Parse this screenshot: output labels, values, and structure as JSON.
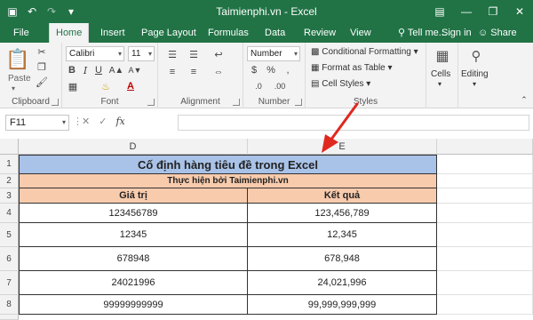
{
  "window": {
    "title": "Taimienphi.vn - Excel"
  },
  "tabs": [
    {
      "label": "File"
    },
    {
      "label": "Home"
    },
    {
      "label": "Insert"
    },
    {
      "label": "Page Layout"
    },
    {
      "label": "Formulas"
    },
    {
      "label": "Data"
    },
    {
      "label": "Review"
    },
    {
      "label": "View"
    }
  ],
  "tell_me": "Tell me...",
  "sign_in": "Sign in",
  "share": "Share",
  "ribbon": {
    "clipboard": {
      "paste_label": "Paste",
      "group_label": "Clipboard"
    },
    "font": {
      "family": "Calibri",
      "size": "11",
      "group_label": "Font"
    },
    "alignment": {
      "group_label": "Alignment"
    },
    "number": {
      "format": "Number",
      "group_label": "Number"
    },
    "styles": {
      "conditional_formatting": "Conditional Formatting",
      "format_as_table": "Format as Table",
      "cell_styles": "Cell Styles",
      "group_label": "Styles"
    },
    "cells": {
      "label": "Cells"
    },
    "editing": {
      "label": "Editing"
    }
  },
  "formula_bar": {
    "name_box": "F11",
    "cancel": "✕",
    "enter": "✓",
    "fx": "fx"
  },
  "sheet": {
    "columns": [
      "D",
      "E"
    ],
    "rows": [
      "1",
      "2",
      "3",
      "4",
      "5",
      "6",
      "7",
      "8"
    ],
    "title": "Cố định hàng tiêu đề trong Excel",
    "subtitle": "Thực hiện bởi Taimienphi.vn",
    "headers": [
      "Giá trị",
      "Kết quả"
    ],
    "data": [
      [
        "123456789",
        "123,456,789"
      ],
      [
        "12345",
        "12,345"
      ],
      [
        "678948",
        "678,948"
      ],
      [
        "24021996",
        "24,021,996"
      ],
      [
        "99999999999",
        "99,999,999,999"
      ]
    ]
  },
  "colors": {
    "excel_green": "#217346",
    "title_fill": "#a9c3e8",
    "header_fill": "#f8cbad",
    "arrow": "#e0281f"
  }
}
